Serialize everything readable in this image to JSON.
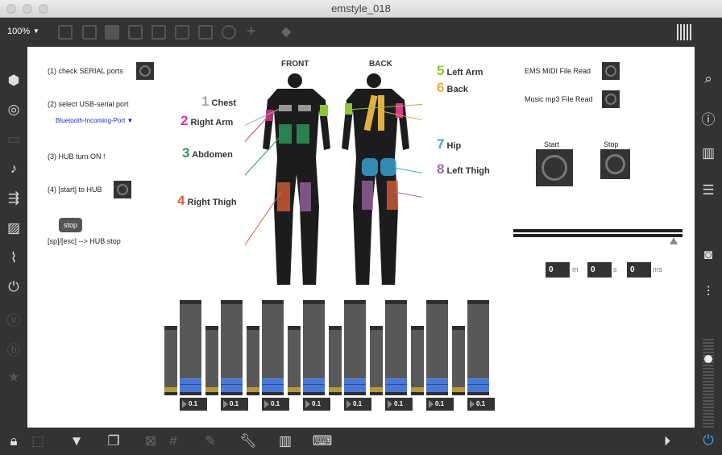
{
  "window": {
    "title": "emstyle_018"
  },
  "toolbar": {
    "zoom": "100%"
  },
  "steps": {
    "s1": "(1) check SERIAL ports",
    "s2": "(2) select USB-serial port",
    "port": "Bluetooth-Incoming-Port",
    "s3": "(3) HUB turn ON !",
    "s4": "(4) [start] to HUB",
    "stop": "stop",
    "stop_hint": "[sp]/[esc] --> HUB stop"
  },
  "suit": {
    "front": "FRONT",
    "back": "BACK",
    "labels": [
      {
        "n": "1",
        "name": "Chest",
        "color": "#aaaaaa"
      },
      {
        "n": "2",
        "name": "Right Arm",
        "color": "#d63c8c"
      },
      {
        "n": "3",
        "name": "Abdomen",
        "color": "#2e9a5a"
      },
      {
        "n": "4",
        "name": "Right Thigh",
        "color": "#e0603a"
      },
      {
        "n": "5",
        "name": "Left Arm",
        "color": "#8cc43a"
      },
      {
        "n": "6",
        "name": "Back",
        "color": "#e0b040"
      },
      {
        "n": "7",
        "name": "Hip",
        "color": "#3aa8d8"
      },
      {
        "n": "8",
        "name": "Left Thigh",
        "color": "#9a6aa8"
      }
    ]
  },
  "right": {
    "midi": "EMS MIDI File Read",
    "mp3": "Music mp3 File Read",
    "start": "Start",
    "stop": "Stop",
    "time": {
      "m": "0",
      "s": "0",
      "ms": "0",
      "m_unit": "m",
      "s_unit": "s",
      "ms_unit": "ms"
    },
    "progress": 1.0
  },
  "channels": [
    {
      "value": "0.1"
    },
    {
      "value": "0.1"
    },
    {
      "value": "0.1"
    },
    {
      "value": "0.1"
    },
    {
      "value": "0.1"
    },
    {
      "value": "0.1"
    },
    {
      "value": "0.1"
    },
    {
      "value": "0.1"
    }
  ]
}
